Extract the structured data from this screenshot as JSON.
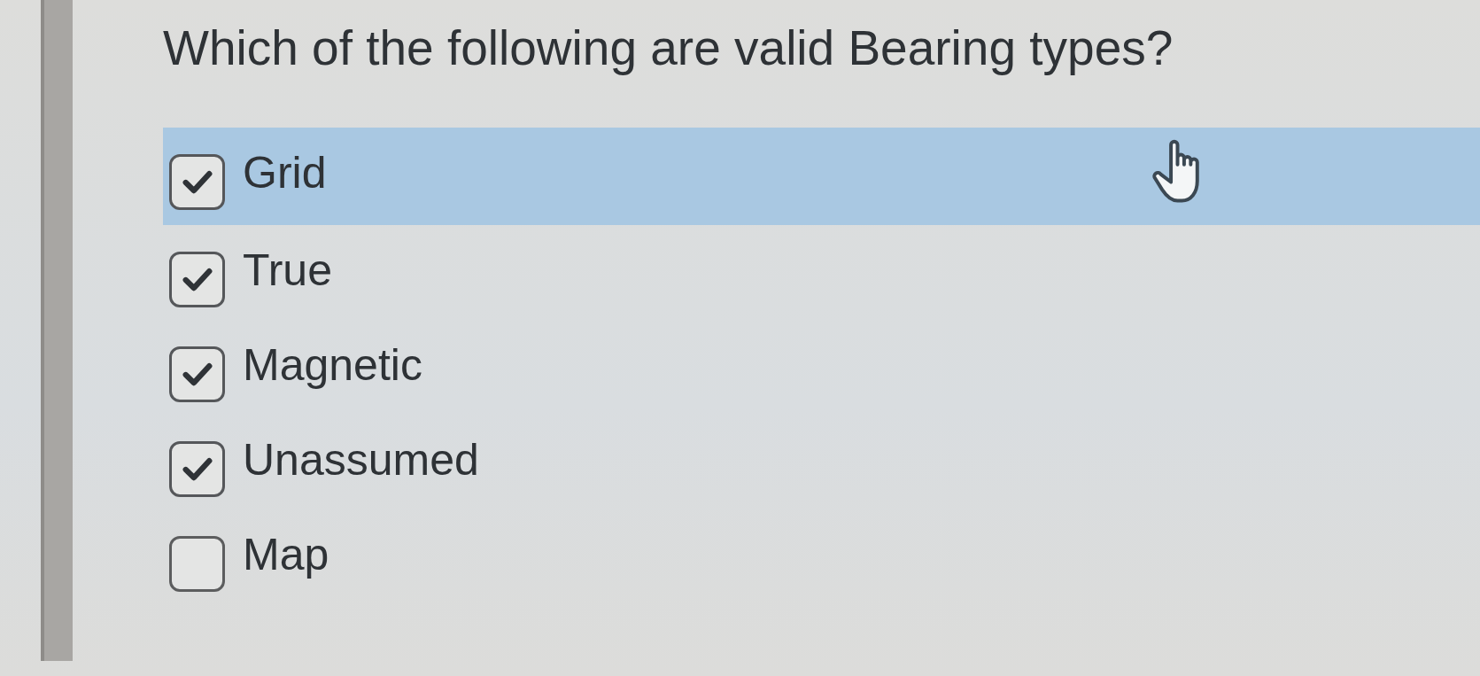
{
  "question": {
    "text": "Which of the following are valid Bearing types?"
  },
  "options": [
    {
      "label": "Grid",
      "checked": true,
      "hovered": true
    },
    {
      "label": "True",
      "checked": true,
      "hovered": false
    },
    {
      "label": "Magnetic",
      "checked": true,
      "hovered": false
    },
    {
      "label": "Unassumed",
      "checked": true,
      "hovered": false
    },
    {
      "label": "Map",
      "checked": false,
      "hovered": false
    }
  ]
}
